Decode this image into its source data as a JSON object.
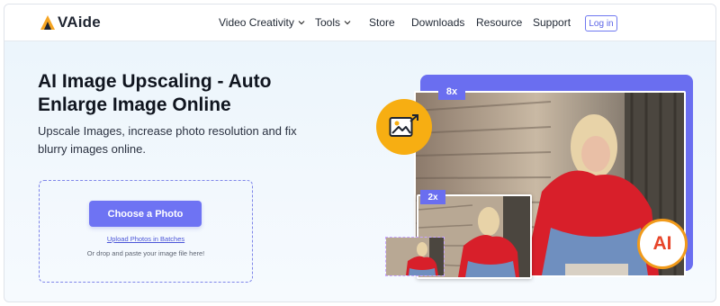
{
  "brand": {
    "name": "VAide",
    "accent": "#6e73f3",
    "logo_color": "#f5a524"
  },
  "nav": {
    "items": [
      {
        "label": "Video Creativity",
        "has_dropdown": true
      },
      {
        "label": "Tools",
        "has_dropdown": true
      },
      {
        "label": "Store",
        "has_dropdown": false
      },
      {
        "label": "Downloads",
        "has_dropdown": false
      },
      {
        "label": "Resource",
        "has_dropdown": false
      },
      {
        "label": "Support",
        "has_dropdown": false
      }
    ],
    "login_label": "Log in"
  },
  "hero": {
    "title": "AI Image Upscaling - Auto Enlarge Image Online",
    "subtitle": "Upscale Images, increase photo resolution and fix blurry images online.",
    "upload": {
      "button_label": "Choose a Photo",
      "batch_link": "Upload Photos in Batches",
      "drop_hint": "Or drop and paste your image file here!"
    },
    "illustration": {
      "scale_large": "8x",
      "scale_medium": "2x",
      "ai_badge": "AI",
      "badge_icon": "image-enlarge-icon",
      "badge_color": "#f7ae12"
    }
  }
}
